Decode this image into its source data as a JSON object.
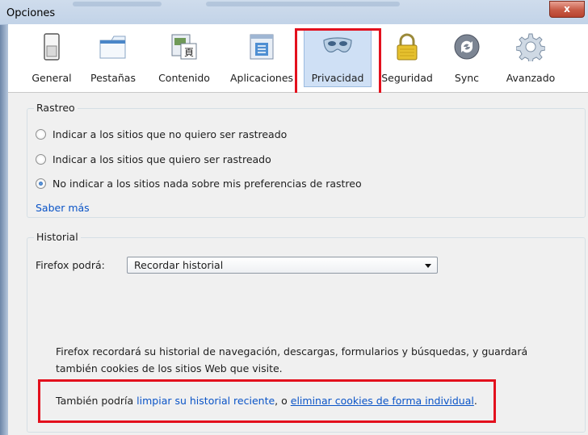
{
  "window": {
    "title": "Opciones",
    "close_label": "x"
  },
  "toolbar": {
    "panes": [
      {
        "label": "General"
      },
      {
        "label": "Pestañas"
      },
      {
        "label": "Contenido"
      },
      {
        "label": "Aplicaciones"
      },
      {
        "label": "Privacidad"
      },
      {
        "label": "Seguridad"
      },
      {
        "label": "Sync"
      },
      {
        "label": "Avanzado"
      }
    ]
  },
  "tracking": {
    "legend": "Rastreo",
    "options": [
      {
        "label": "Indicar a los sitios que no quiero ser rastreado",
        "checked": false
      },
      {
        "label": "Indicar a los sitios que quiero ser rastreado",
        "checked": false
      },
      {
        "label": "No indicar a los sitios nada sobre mis preferencias de rastreo",
        "checked": true
      }
    ],
    "learn_more": "Saber más"
  },
  "history": {
    "legend": "Historial",
    "firefox_will_label": "Firefox podrá:",
    "mode_value": "Recordar historial",
    "description_line1": "Firefox recordará su historial de navegación, descargas, formularios y búsquedas, y guardará",
    "description_line2": "también cookies de los sitios Web que visite.",
    "also_prefix": "También podría ",
    "clear_link": "limpiar su historial reciente",
    "also_middle": ", o ",
    "cookies_link": "eliminar cookies de forma individual",
    "also_suffix": "."
  },
  "colors": {
    "highlight": "#e3101d",
    "link": "#0a54c7",
    "selected_pane": "#cfe0f5"
  }
}
